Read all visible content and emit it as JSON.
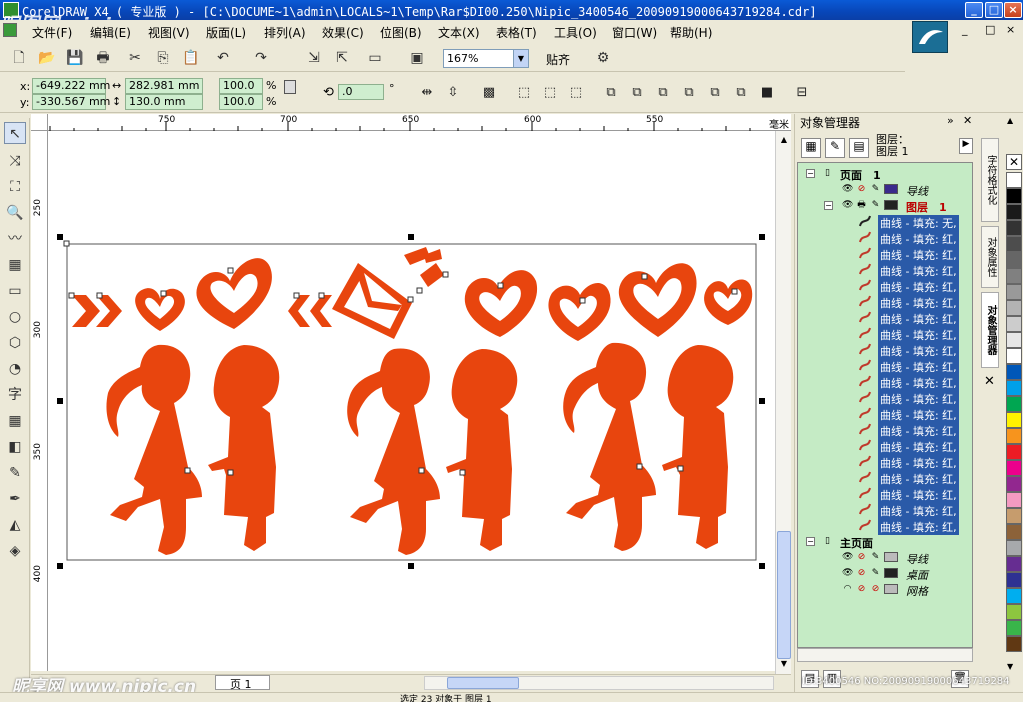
{
  "window": {
    "title": "CorelDRAW X4 ( 专业版 ) - [C:\\DOCUME~1\\admin\\LOCALS~1\\Temp\\Rar$DI00.250\\Nipic_3400546_20090919000643719284.cdr]",
    "minimize": "_",
    "maximize": "□",
    "close": "×"
  },
  "menu": [
    "文件(F)",
    "编辑(E)",
    "视图(V)",
    "版面(L)",
    "排列(A)",
    "效果(C)",
    "位图(B)",
    "文本(X)",
    "表格(T)",
    "工具(O)",
    "窗口(W)",
    "帮助(H)"
  ],
  "toolbar": {
    "zoom": "167%",
    "snap_label": "贴齐"
  },
  "propbar": {
    "x_label": "x:",
    "y_label": "y:",
    "x_value": "-649.222 mm",
    "y_value": "-330.567 mm",
    "width_value": "282.981 mm",
    "height_value": "130.0 mm",
    "scale_x": "100.0",
    "scale_y": "100.0",
    "percent": "%",
    "angle_value": ".0",
    "degree": "°"
  },
  "rulers": {
    "top_ticks": [
      "750",
      "700",
      "650",
      "600",
      "550"
    ],
    "left_ticks": [
      "250",
      "300",
      "350",
      "400"
    ],
    "unit": "毫米"
  },
  "colors": {
    "figure_fill": "#e8450e",
    "tree_bg": "#c5ebc5",
    "selection": "#2a5aa8"
  },
  "docker": {
    "title": "对象管理器",
    "layer_label_1": "图层：",
    "layer_label_2": "图层 1",
    "page1": "页面　1",
    "guides": "导线",
    "layer1": "图层　1",
    "curves": [
      "曲线 - 填充: 无,",
      "曲线 - 填充: 红,",
      "曲线 - 填充: 红,",
      "曲线 - 填充: 红,",
      "曲线 - 填充: 红,",
      "曲线 - 填充: 红,",
      "曲线 - 填充: 红,",
      "曲线 - 填充: 红,",
      "曲线 - 填充: 红,",
      "曲线 - 填充: 红,",
      "曲线 - 填充: 红,",
      "曲线 - 填充: 红,",
      "曲线 - 填充: 红,",
      "曲线 - 填充: 红,",
      "曲线 - 填充: 红,",
      "曲线 - 填充: 红,",
      "曲线 - 填充: 红,",
      "曲线 - 填充: 红,",
      "曲线 - 填充: 红,",
      "曲线 - 填充: 红,"
    ],
    "master_page": "主页面",
    "master_guides": "导线",
    "desktop": "桌面",
    "grid": "网格"
  },
  "side_tabs": [
    "字符格式化",
    "对象属性",
    "对象管理器"
  ],
  "palette": [
    "#ffffff",
    "#000000",
    "#1a1a1a",
    "#333333",
    "#4d4d4d",
    "#666666",
    "#808080",
    "#999999",
    "#b3b3b3",
    "#cccccc",
    "#e6e6e6",
    "#ffffff",
    "#0057b8",
    "#00a0e9",
    "#00a651",
    "#fff200",
    "#f7941d",
    "#ed1c24",
    "#ec008c",
    "#92278f",
    "#f49ac1",
    "#c69c6d",
    "#8c6239",
    "#a7a9ac",
    "#662d91",
    "#2e3192",
    "#00aeef",
    "#8dc63f",
    "#39b54a",
    "#603813"
  ],
  "status": {
    "page_tab": "页 1",
    "bottom_text": "选定 23 对象于 图层 1"
  },
  "watermarks": {
    "top": "昵图网 nipic.com",
    "bottom": "昵享网 www.nipic.cn",
    "id": "ID:3400546 NO:20090919000643719284"
  }
}
